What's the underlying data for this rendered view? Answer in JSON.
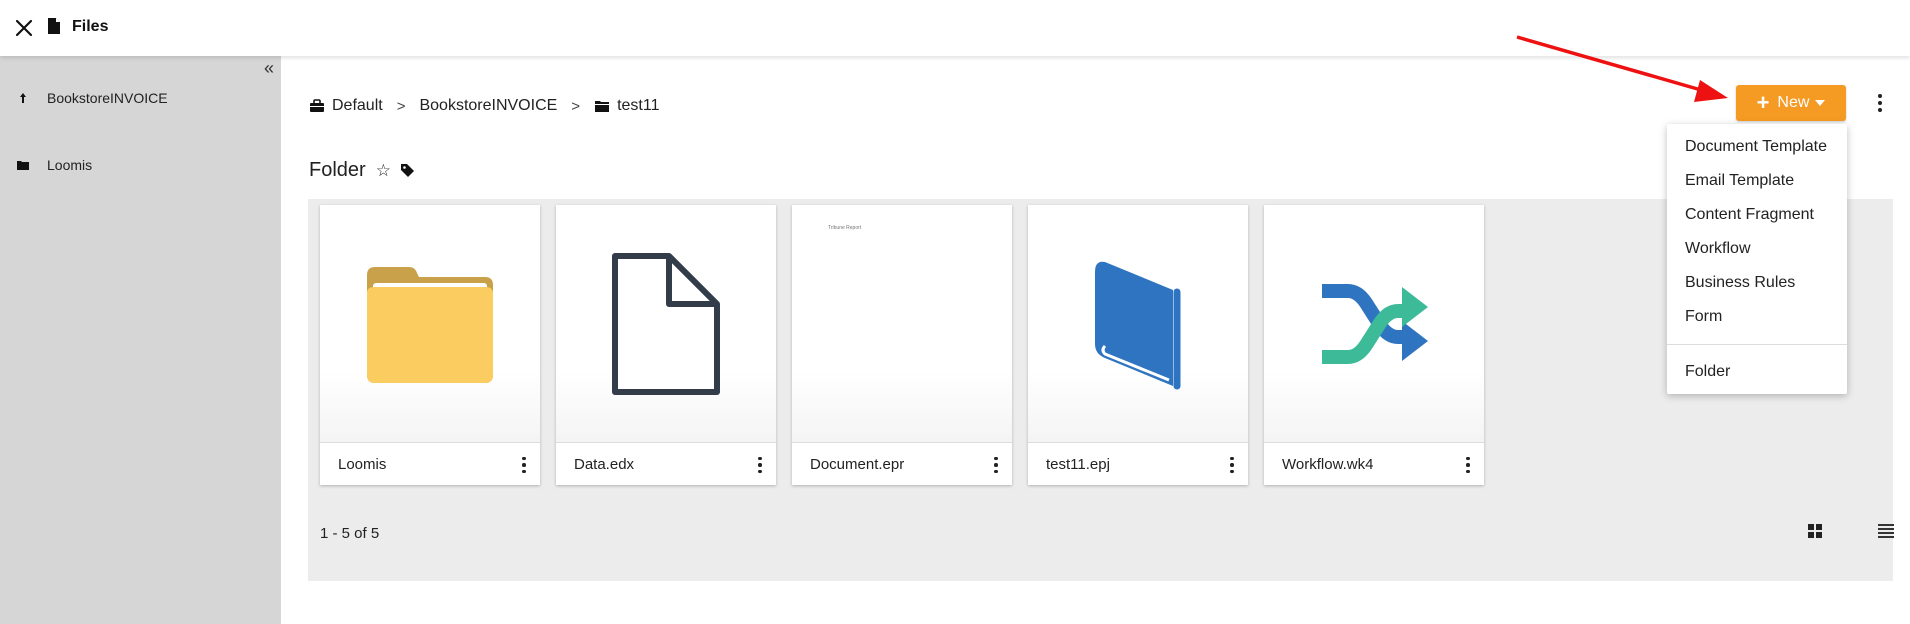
{
  "topbar": {
    "title": "Files",
    "close_icon": "close-icon",
    "file_icon": "file-icon"
  },
  "sidebar": {
    "items": [
      {
        "label": "BookstoreINVOICE",
        "icon": "up-arrow-icon"
      },
      {
        "label": "Loomis",
        "icon": "folder-icon"
      }
    ]
  },
  "breadcrumb": [
    {
      "label": "Default",
      "icon": "briefcase-icon"
    },
    {
      "label": "BookstoreINVOICE"
    },
    {
      "label": "test11",
      "icon": "folder-icon"
    }
  ],
  "header": {
    "new_label": "New",
    "folder_title": "Folder",
    "star_glyph": "☆"
  },
  "files": [
    {
      "name": "Loomis",
      "type": "folder"
    },
    {
      "name": "Data.edx",
      "type": "data"
    },
    {
      "name": "Document.epr",
      "type": "document",
      "preview": "Tribune Report"
    },
    {
      "name": "test11.epj",
      "type": "project"
    },
    {
      "name": "Workflow.wk4",
      "type": "workflow"
    }
  ],
  "pager": {
    "text": "1 - 5 of 5"
  },
  "new_menu": {
    "items": [
      "Document Template",
      "Email Template",
      "Content Fragment",
      "Workflow",
      "Business Rules",
      "Form"
    ],
    "folder_item": "Folder"
  },
  "colors": {
    "accent": "#f59a23",
    "folder": "#fbcd60",
    "book": "#2f74c0",
    "workflow_teal": "#3dbb98",
    "annotation": "#ee1111"
  }
}
